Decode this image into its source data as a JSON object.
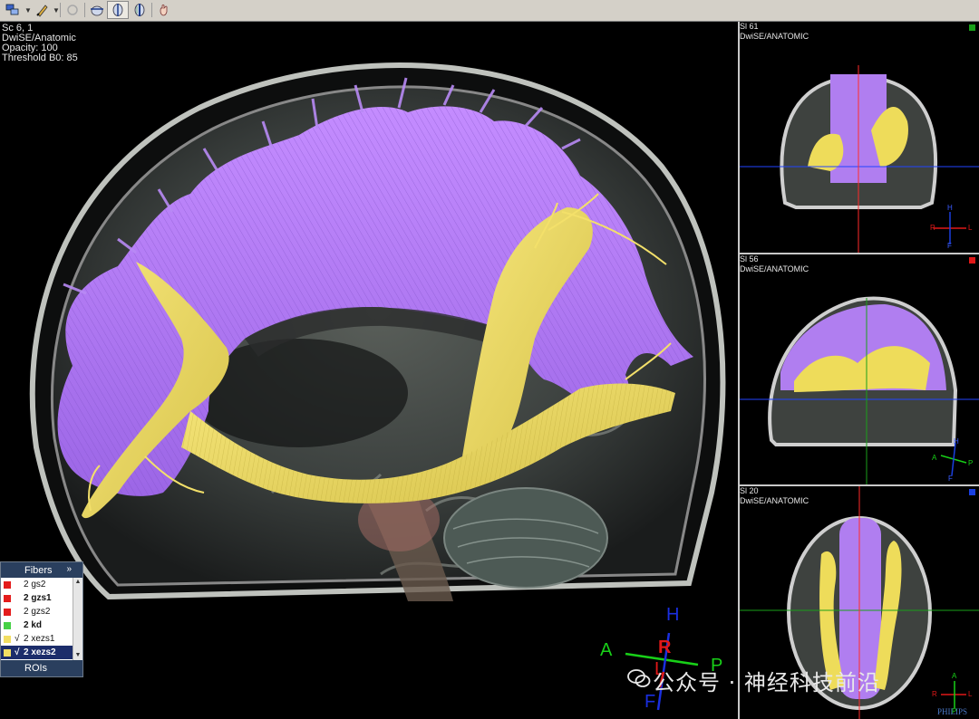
{
  "toolbar": {
    "buttons": [
      {
        "name": "layout-tool-icon"
      },
      {
        "name": "annotate-pen-icon"
      },
      {
        "name": "rotate-disabled-icon"
      },
      {
        "name": "slice-plane-icon"
      },
      {
        "name": "sagittal-view-icon"
      },
      {
        "name": "coronal-view-icon"
      },
      {
        "name": "hand-pan-icon"
      }
    ]
  },
  "main_view": {
    "overlay": {
      "line1": "Sc 6, 1",
      "line2": "DwiSE/Anatomic",
      "line3": "Opacity: 100",
      "line4": "Threshold B0: 85"
    },
    "orientation": {
      "h": "H",
      "a": "A",
      "r": "R",
      "l": "L",
      "p": "P",
      "f": "F"
    }
  },
  "side_views": [
    {
      "title": "Sl 61",
      "subtitle": "DwiSE/ANATOMIC",
      "marker_color": "#1aa01a",
      "orientation": {
        "top": "H",
        "left": "R",
        "right": "L",
        "bottom": "F"
      }
    },
    {
      "title": "Sl 56",
      "subtitle": "DwiSE/ANATOMIC",
      "marker_color": "#e01818",
      "orientation": {
        "top": "H",
        "left": "A",
        "right": "P",
        "bottom": "F"
      }
    },
    {
      "title": "Sl 20",
      "subtitle": "DwiSE/ANATOMIC",
      "marker_color": "#1a3fe0",
      "orientation": {
        "top": "A",
        "left": "R",
        "right": "L",
        "bottom": "P"
      }
    }
  ],
  "fibers_panel": {
    "title": "Fibers",
    "expand": "»",
    "items": [
      {
        "label": "2 gs2",
        "color": "#e41c1c",
        "checked": false,
        "bold": false,
        "selected": false
      },
      {
        "label": "2 gzs1",
        "color": "#e41c1c",
        "checked": false,
        "bold": true,
        "selected": false
      },
      {
        "label": "2 gzs2",
        "color": "#e41c1c",
        "checked": false,
        "bold": false,
        "selected": false
      },
      {
        "label": "2 kd",
        "color": "#46d146",
        "checked": false,
        "bold": true,
        "selected": false
      },
      {
        "label": "2 xezs1",
        "color": "#f2de63",
        "checked": true,
        "bold": false,
        "selected": false
      },
      {
        "label": "2 xezs2",
        "color": "#f2de63",
        "checked": true,
        "bold": true,
        "selected": true
      }
    ],
    "footer": "ROIs"
  },
  "watermark": "公众号 · 神经科技前沿",
  "brand": "PHILIPS",
  "colors": {
    "tract_primary": "#b07ef0",
    "tract_secondary": "#eedc5a"
  }
}
